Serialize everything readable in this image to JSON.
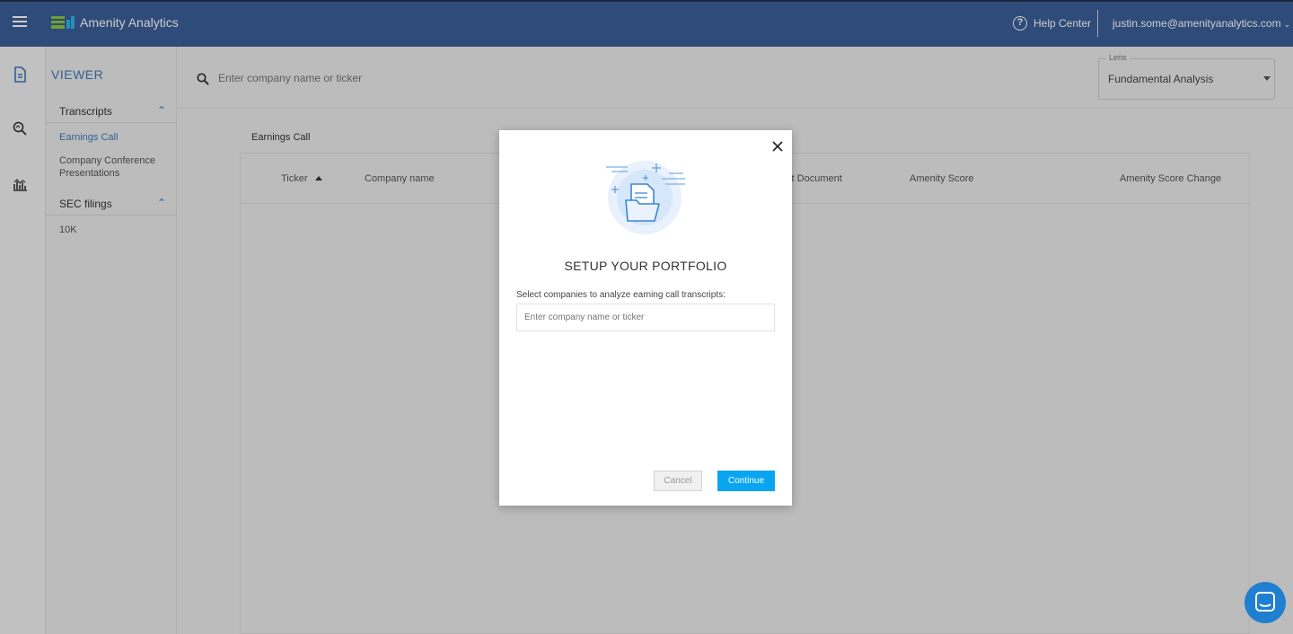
{
  "app": {
    "brand": "Amenity Analytics"
  },
  "topbar": {
    "help_label": "Help Center",
    "user_email": "justin.some@amenityanalytics.com",
    "help_glyph": "?"
  },
  "sidebar": {
    "title": "VIEWER",
    "groups": [
      {
        "label": "Transcripts",
        "items": [
          {
            "label": "Earnings Call",
            "active": true
          },
          {
            "label": "Company Conference Presentations",
            "active": false
          }
        ]
      },
      {
        "label": "SEC filings",
        "items": [
          {
            "label": "10K",
            "active": false
          }
        ]
      }
    ]
  },
  "search": {
    "placeholder": "Enter company name or ticker"
  },
  "lens": {
    "legend": "Lens",
    "value": "Fundamental Analysis"
  },
  "main": {
    "section_label": "Earnings Call",
    "columns": [
      "Ticker",
      "Company name",
      "ıst Document",
      "Amenity Score",
      "Amenity Score Change"
    ]
  },
  "modal": {
    "title": "SETUP YOUR PORTFOLIO",
    "description": "Select companies to analyze earning call transcripts:",
    "input_placeholder": "Enter company name or ticker",
    "cancel_label": "Cancel",
    "continue_label": "Continue"
  },
  "colors": {
    "topbar": "#3b5e98",
    "accent": "#3c7ab7",
    "primary_button": "#0aa5f0",
    "chat": "#1f7fd0"
  },
  "icons": [
    "menu-icon",
    "logo-icon",
    "help-icon",
    "chevron-down-icon",
    "document-icon",
    "search-analytics-icon",
    "chart-icon",
    "search-icon",
    "close-icon",
    "folder-illustration",
    "chat-icon"
  ]
}
